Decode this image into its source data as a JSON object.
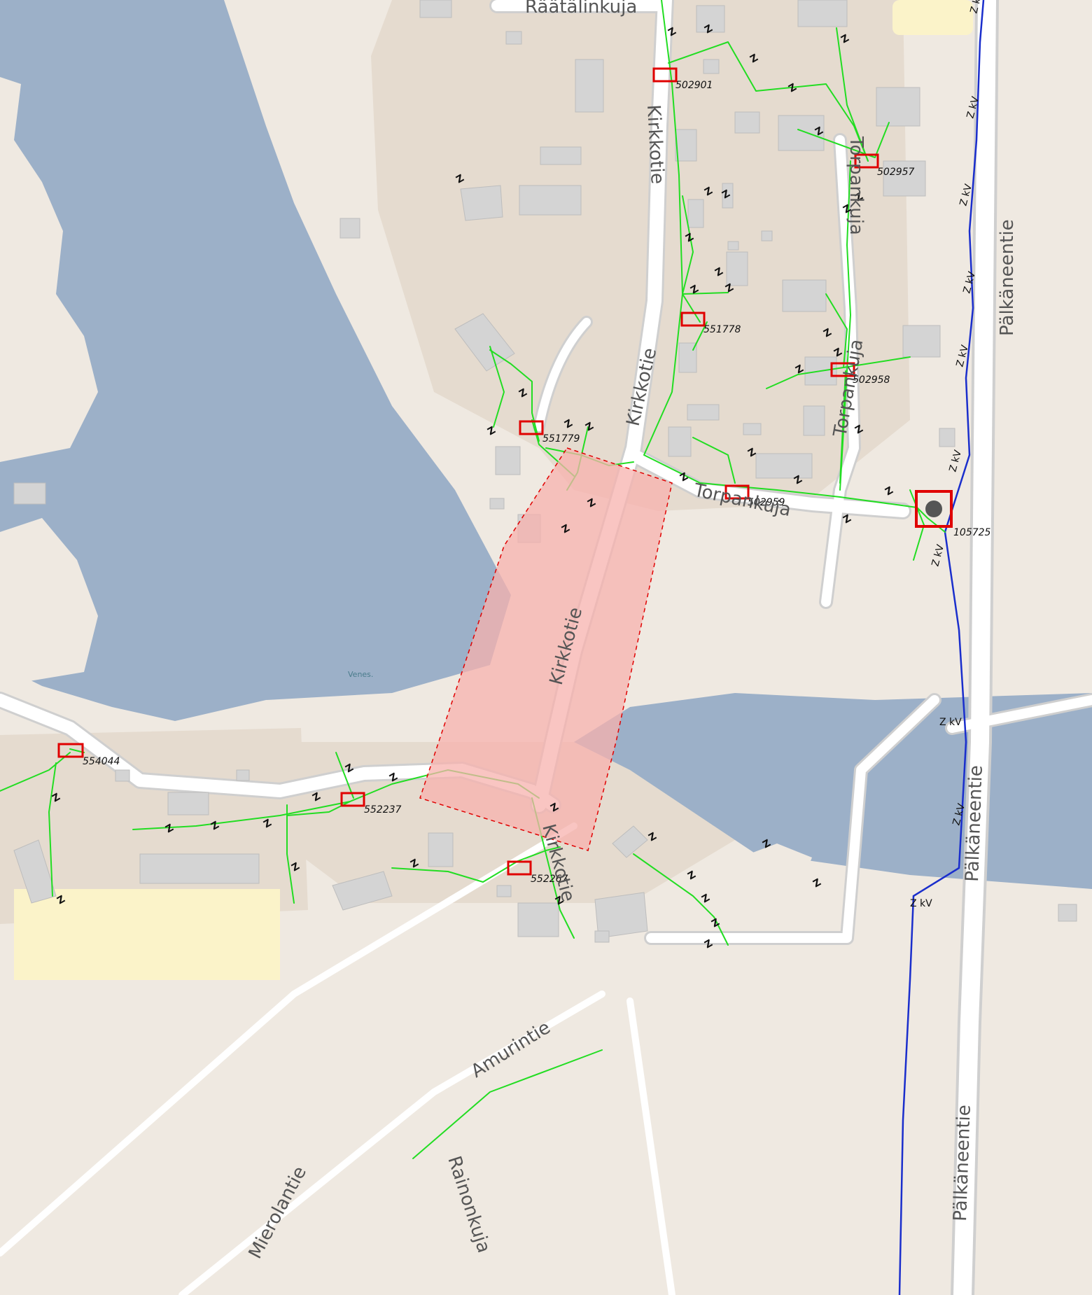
{
  "map": {
    "colors": {
      "land": "#efe9e1",
      "residential": "#e5dbcf",
      "water": "#9cb0c8",
      "park": "#fbf3c9",
      "building": "#d4d4d4",
      "road": "#ffffff",
      "lv_line": "#22dd22",
      "mv_line": "#1a2ecc",
      "station": "#e00000",
      "area_fill": "#f7b2ad",
      "area_stroke": "#e00000"
    },
    "streets": [
      {
        "id": "raatalinkuja",
        "name": "Räätälinkuja"
      },
      {
        "id": "kirkkotie-1",
        "name": "Kirkkotie"
      },
      {
        "id": "kirkkotie-2",
        "name": "Kirkkotie"
      },
      {
        "id": "kirkkotie-3",
        "name": "Kirkkotie"
      },
      {
        "id": "kirkkotie-4",
        "name": "Kirkkotie"
      },
      {
        "id": "torpankuja-1",
        "name": "Torpankuja"
      },
      {
        "id": "torpankuja-2",
        "name": "Torpankuja"
      },
      {
        "id": "torpankuja-3",
        "name": "Torpankuja"
      },
      {
        "id": "palkaneentie-1",
        "name": "Pälkäneentie"
      },
      {
        "id": "palkaneentie-2",
        "name": "Pälkäneentie"
      },
      {
        "id": "palkaneentie-3",
        "name": "Pälkäneentie"
      },
      {
        "id": "mierolantie",
        "name": "Mierolantie"
      },
      {
        "id": "rainonkuja",
        "name": "Rainonkuja"
      },
      {
        "id": "amurintie",
        "name": "Amurintie"
      }
    ],
    "water_labels": [
      {
        "id": "venes",
        "text": "Venes."
      }
    ],
    "stations": [
      {
        "id": "502901",
        "label": "502901"
      },
      {
        "id": "502957",
        "label": "502957"
      },
      {
        "id": "551778",
        "label": "551778"
      },
      {
        "id": "502958",
        "label": "502958"
      },
      {
        "id": "551779",
        "label": "551779"
      },
      {
        "id": "502959",
        "label": "502959"
      },
      {
        "id": "105725",
        "label": "105725"
      },
      {
        "id": "554044",
        "label": "554044"
      },
      {
        "id": "552237",
        "label": "552237"
      },
      {
        "id": "552267",
        "label": "552267"
      }
    ],
    "line_markers": {
      "lv": "Z",
      "mv": "Z kV"
    }
  }
}
